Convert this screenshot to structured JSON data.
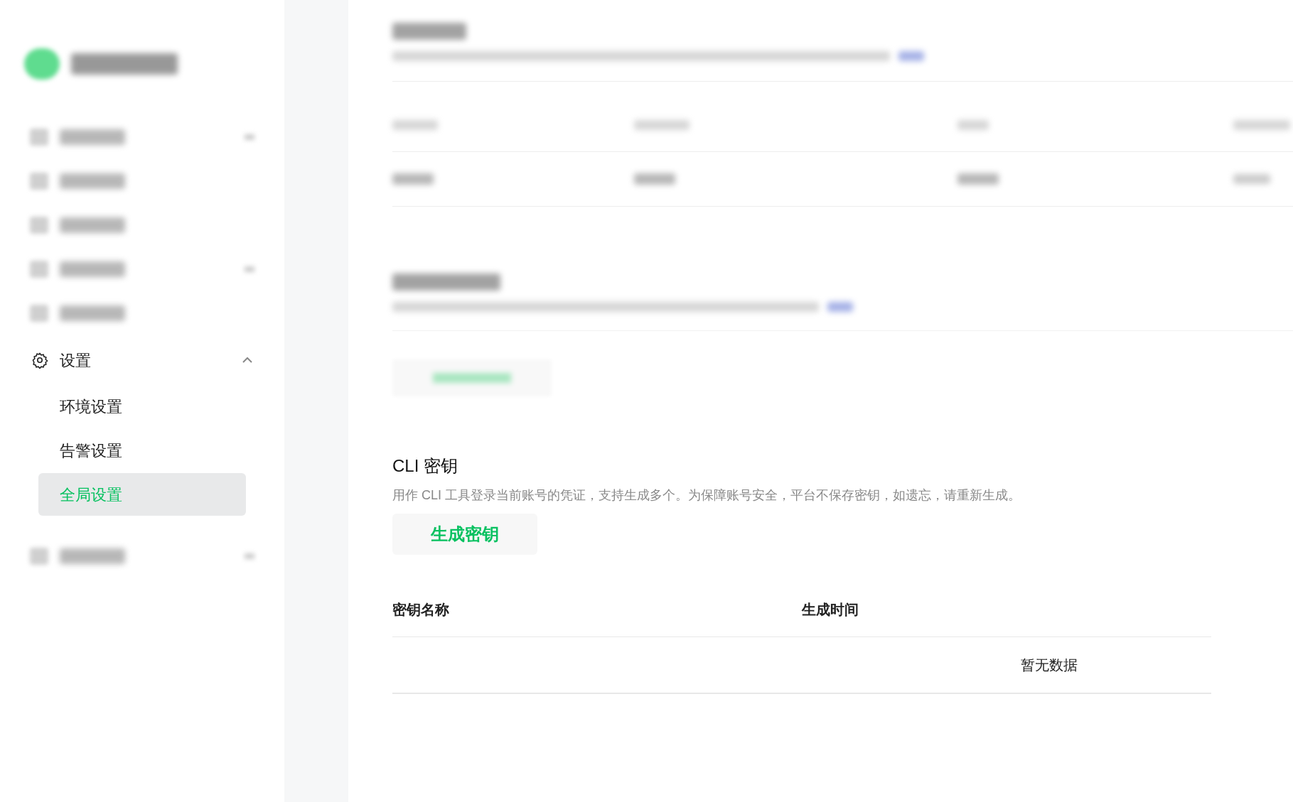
{
  "sidebar": {
    "group": {
      "label": "设置",
      "expanded": true,
      "children": [
        {
          "label": "环境设置",
          "selected": false
        },
        {
          "label": "告警设置",
          "selected": false
        },
        {
          "label": "全局设置",
          "selected": true
        }
      ]
    }
  },
  "cli_section": {
    "title": "CLI 密钥",
    "description": "用作 CLI 工具登录当前账号的凭证，支持生成多个。为保障账号安全，平台不保存密钥，如遗忘，请重新生成。",
    "button": "生成密钥",
    "table": {
      "columns": [
        "密钥名称",
        "生成时间"
      ],
      "empty_text": "暂无数据"
    }
  }
}
